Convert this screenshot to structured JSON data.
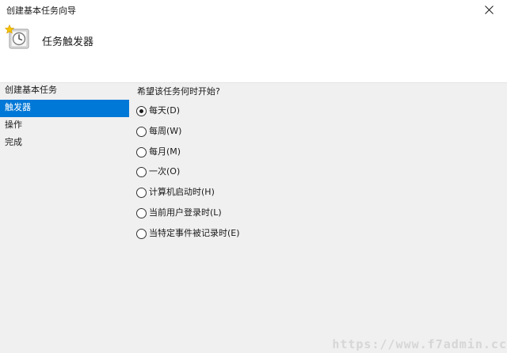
{
  "window": {
    "title": "创建基本任务向导",
    "close_icon": "close-icon"
  },
  "header": {
    "icon": "task-clock-icon",
    "title": "任务触发器"
  },
  "nav": {
    "items": [
      {
        "label": "创建基本任务",
        "selected": false
      },
      {
        "label": "触发器",
        "selected": true
      },
      {
        "label": "操作",
        "selected": false
      },
      {
        "label": "完成",
        "selected": false
      }
    ]
  },
  "main": {
    "question": "希望该任务何时开始?",
    "options": [
      {
        "label": "每天(D)",
        "checked": true
      },
      {
        "label": "每周(W)",
        "checked": false
      },
      {
        "label": "每月(M)",
        "checked": false
      },
      {
        "label": "一次(O)",
        "checked": false
      },
      {
        "label": "计算机启动时(H)",
        "checked": false
      },
      {
        "label": "当前用户登录时(L)",
        "checked": false
      },
      {
        "label": "当特定事件被记录时(E)",
        "checked": false
      }
    ]
  },
  "watermark": "https://www.f7admin.cc",
  "colors": {
    "selection": "#0078d7",
    "background": "#f0f0f0",
    "header_bg": "#ffffff"
  }
}
